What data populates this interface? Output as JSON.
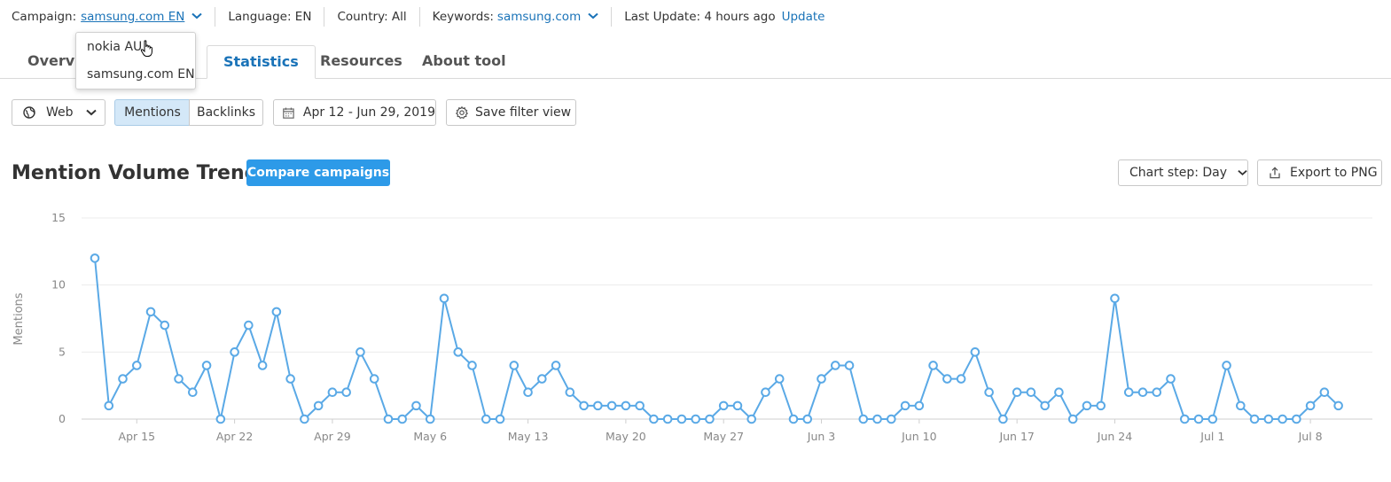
{
  "topbar": {
    "campaign_label": "Campaign:",
    "campaign_value": "samsung.com EN",
    "language": "Language: EN",
    "country": "Country: All",
    "keywords_label": "Keywords:",
    "keywords_value": "samsung.com",
    "last_update": "Last Update: 4 hours ago",
    "update_link": "Update"
  },
  "campaign_dropdown": {
    "options": [
      "nokia AU",
      "samsung.com EN"
    ]
  },
  "tabs": [
    {
      "label": "Overview",
      "visible_text": "Overvi"
    },
    {
      "label": "Statistics"
    },
    {
      "label": "Resources"
    },
    {
      "label": "About tool"
    }
  ],
  "filters": {
    "web": "Web",
    "mentions": "Mentions",
    "backlinks": "Backlinks",
    "date_range": "Apr 12 - Jun 29, 2019",
    "save_filter": "Save filter view"
  },
  "section": {
    "title": "Mention Volume Trend",
    "compare": "Compare campaigns",
    "chart_step": "Chart step: Day",
    "export": "Export to PNG"
  },
  "colors": {
    "accent": "#2d9ae8",
    "line": "#5aa9e6",
    "link": "#1a73b8"
  },
  "chart_data": {
    "type": "line",
    "ylabel": "Mentions",
    "xlabel": "",
    "ylim": [
      0,
      15
    ],
    "yticks": [
      0,
      5,
      10,
      15
    ],
    "grid": true,
    "xtick_labels": [
      "Apr 15",
      "Apr 22",
      "Apr 29",
      "May 6",
      "May 13",
      "May 20",
      "May 27",
      "Jun 3",
      "Jun 10",
      "Jun 17",
      "Jun 24",
      "Jul 1",
      "Jul 8"
    ],
    "x_start": "Apr 12",
    "x_end": "Jul 10",
    "series": [
      {
        "values": [
          12,
          1,
          3,
          4,
          8,
          7,
          3,
          2,
          4,
          0,
          5,
          7,
          4,
          8,
          3,
          0,
          1,
          2,
          2,
          5,
          3,
          0,
          0,
          1,
          0,
          9,
          5,
          4,
          0,
          0,
          4,
          2,
          3,
          4,
          2,
          1,
          1,
          1,
          1,
          1,
          0,
          0,
          0,
          0,
          0,
          1,
          1,
          0,
          2,
          3,
          0,
          0,
          3,
          4,
          4,
          0,
          0,
          0,
          1,
          1,
          4,
          3,
          3,
          5,
          2,
          0,
          2,
          2,
          1,
          2,
          0,
          1,
          1,
          9,
          2,
          2,
          2,
          3,
          0,
          0,
          0,
          4,
          1,
          0,
          0,
          0,
          0,
          1,
          2,
          1
        ]
      }
    ]
  }
}
